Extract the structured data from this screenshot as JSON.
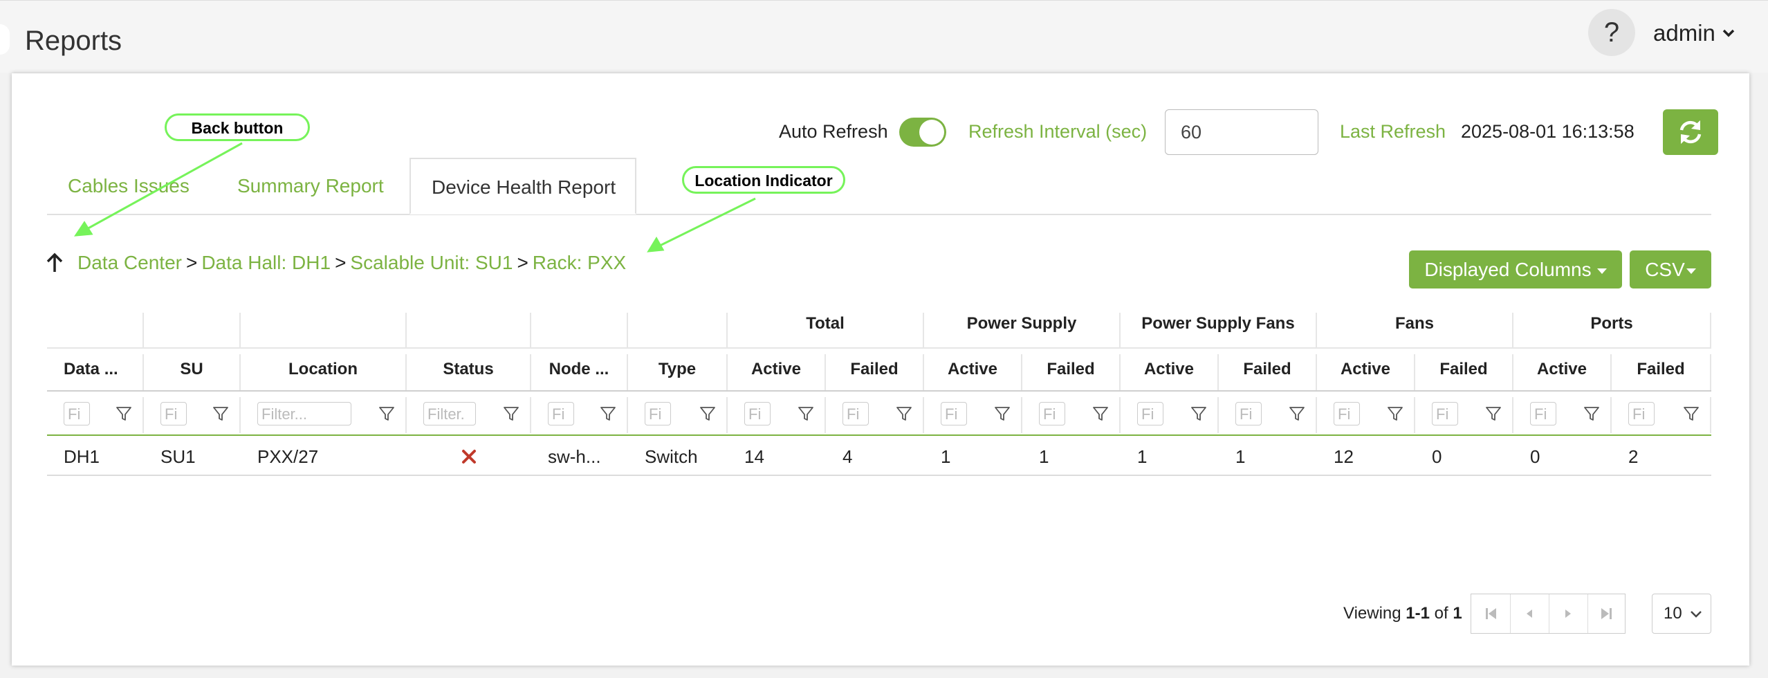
{
  "header": {
    "title": "Reports",
    "help_label": "?",
    "user": "admin"
  },
  "toolbar": {
    "auto_refresh_label": "Auto Refresh",
    "auto_refresh_on": true,
    "refresh_interval_label": "Refresh Interval (sec)",
    "refresh_interval_value": "60",
    "last_refresh_label": "Last Refresh",
    "last_refresh_value": "2025-08-01 16:13:58"
  },
  "tabs": [
    {
      "label": "Cables Issues",
      "active": false
    },
    {
      "label": "Summary Report",
      "active": false
    },
    {
      "label": "Device Health Report",
      "active": true
    }
  ],
  "breadcrumb": {
    "items": [
      "Data Center",
      "Data Hall: DH1",
      "Scalable Unit: SU1",
      "Rack: PXX"
    ],
    "separator": ">"
  },
  "buttons": {
    "displayed_columns": "Displayed Columns",
    "csv": "CSV"
  },
  "table": {
    "groups": [
      "Total",
      "Power Supply",
      "Power Supply Fans",
      "Fans",
      "Ports"
    ],
    "columns": [
      "Data ...",
      "SU",
      "Location",
      "Status",
      "Node ...",
      "Type",
      "Active",
      "Failed",
      "Active",
      "Failed",
      "Active",
      "Failed",
      "Active",
      "Failed",
      "Active",
      "Failed"
    ],
    "filter_placeholders": [
      "Fi",
      "Fi",
      "Filter...",
      "Filter.",
      "Fi",
      "Fi",
      "Fi",
      "Fi",
      "Fi",
      "Fi",
      "Fi",
      "Fi",
      "Fi",
      "Fi",
      "Fi",
      "Fi"
    ],
    "rows": [
      {
        "cells": [
          "DH1",
          "SU1",
          "PXX/27",
          "",
          "sw-h...",
          "Switch",
          "14",
          "4",
          "1",
          "1",
          "1",
          "1",
          "12",
          "0",
          "0",
          "2"
        ],
        "status": "failed"
      }
    ]
  },
  "pagination": {
    "viewing_prefix": "Viewing",
    "range": "1-1",
    "of_word": "of",
    "total": "1",
    "page_size": "10"
  },
  "annotations": {
    "back": "Back button",
    "location": "Location Indicator"
  },
  "colors": {
    "accent": "#7cb342",
    "status_failed": "#c0392b",
    "annotation": "#76f35a"
  }
}
